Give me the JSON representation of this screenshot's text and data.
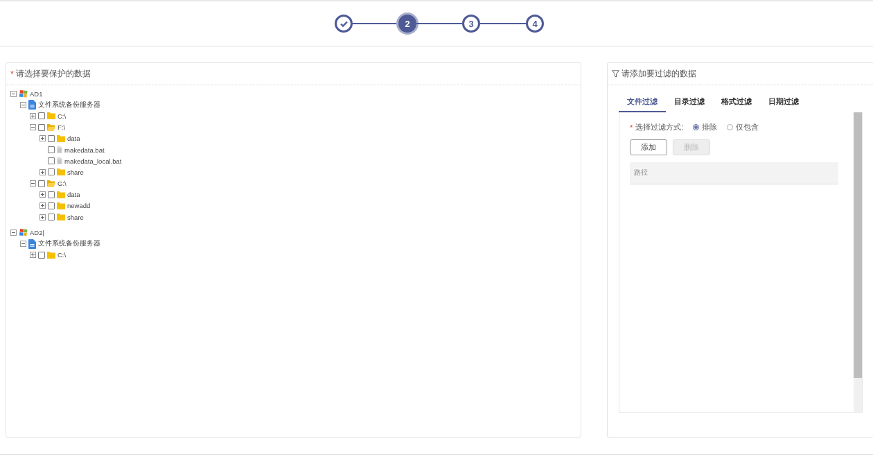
{
  "steps": [
    {
      "kind": "done"
    },
    {
      "kind": "current",
      "label": "2"
    },
    {
      "kind": "todo",
      "label": "3"
    },
    {
      "kind": "todo",
      "label": "4"
    }
  ],
  "source_panel": {
    "required_mark": "*",
    "title": "请选择要保护的数据",
    "tree": [
      {
        "kind": "host",
        "label": "AD1",
        "expanded": true,
        "children": [
          {
            "kind": "server",
            "label": "文件系统备份服务器",
            "expanded": true,
            "children": [
              {
                "kind": "folder",
                "label": "C:\\",
                "expanded": false,
                "checked": false
              },
              {
                "kind": "folder",
                "label": "F:\\",
                "expanded": true,
                "checked": false,
                "children": [
                  {
                    "kind": "folder",
                    "label": "data",
                    "expanded": false,
                    "checked": false
                  },
                  {
                    "kind": "file",
                    "label": "makedata.bat",
                    "checked": false
                  },
                  {
                    "kind": "file",
                    "label": "makedata_local.bat",
                    "checked": false
                  },
                  {
                    "kind": "folder",
                    "label": "share",
                    "expanded": false,
                    "checked": false
                  }
                ]
              },
              {
                "kind": "folder",
                "label": "G:\\",
                "expanded": true,
                "checked": false,
                "children": [
                  {
                    "kind": "folder",
                    "label": "data",
                    "expanded": false,
                    "checked": false
                  },
                  {
                    "kind": "folder",
                    "label": "newadd",
                    "expanded": false,
                    "checked": false
                  },
                  {
                    "kind": "folder",
                    "label": "share",
                    "expanded": false,
                    "checked": false
                  }
                ]
              }
            ]
          }
        ]
      },
      {
        "kind": "host",
        "label": "AD2|",
        "expanded": true,
        "children": [
          {
            "kind": "server",
            "label": "文件系统备份服务器",
            "expanded": true,
            "children": [
              {
                "kind": "folder",
                "label": "C:\\",
                "expanded": false,
                "checked": false
              }
            ]
          }
        ]
      }
    ]
  },
  "filter_panel": {
    "title": "请添加要过滤的数据",
    "tabs": [
      {
        "label": "文件过滤",
        "selected": true
      },
      {
        "label": "目录过滤",
        "selected": false
      },
      {
        "label": "格式过滤",
        "selected": false
      },
      {
        "label": "日期过滤",
        "selected": false
      }
    ],
    "mode": {
      "required_mark": "*",
      "label": "选择过滤方式:",
      "options": [
        {
          "label": "排除",
          "selected": true
        },
        {
          "label": "仅包含",
          "selected": false
        }
      ]
    },
    "buttons": [
      {
        "label": "添加",
        "disabled": false
      },
      {
        "label": "删除",
        "disabled": true
      }
    ],
    "table": {
      "columns": [
        "路径"
      ]
    }
  }
}
